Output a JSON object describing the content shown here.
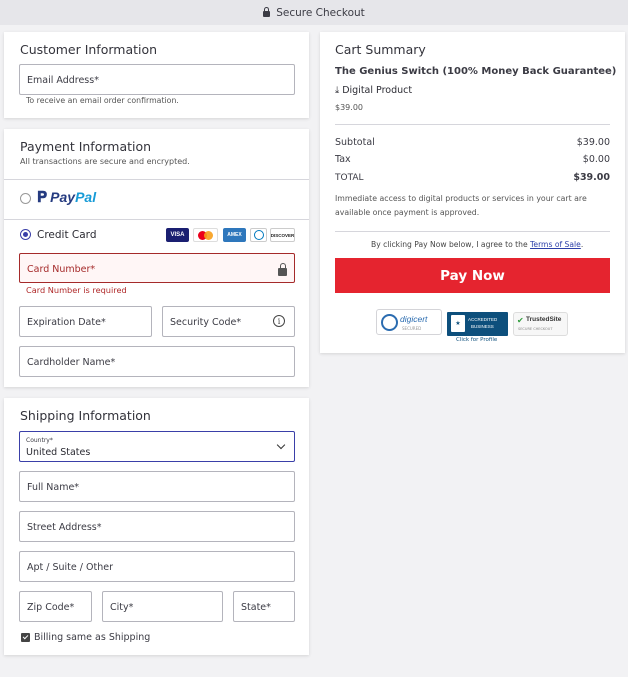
{
  "header": {
    "title": "Secure Checkout"
  },
  "customer": {
    "title": "Customer Information",
    "email_label": "Email Address*",
    "email_hint": "To receive an email order confirmation."
  },
  "payment": {
    "title": "Payment Information",
    "subtitle": "All transactions are secure and encrypted.",
    "paypal_a": "Pay",
    "paypal_b": "Pal",
    "credit_card_label": "Credit Card",
    "card_logos": [
      "VISA",
      "mastercard",
      "AMEX",
      "Diners",
      "DISCOVER"
    ],
    "card_number_label": "Card Number*",
    "card_number_error": "Card Number is required",
    "expiration_label": "Expiration Date*",
    "security_code_label": "Security Code*",
    "cardholder_label": "Cardholder Name*",
    "info_glyph": "i"
  },
  "shipping": {
    "title": "Shipping Information",
    "country_label": "Country*",
    "country_value": "United States",
    "full_name_label": "Full Name*",
    "street_label": "Street Address*",
    "apt_label": "Apt / Suite / Other",
    "zip_label": "Zip Code*",
    "city_label": "City*",
    "state_label": "State*",
    "billing_same_label": "Billing same as Shipping"
  },
  "cart": {
    "title": "Cart Summary",
    "product_name": "The Genius Switch (100% Money Back Guarantee)",
    "product_type": "Digital Product",
    "product_price": "$39.00",
    "subtotal_label": "Subtotal",
    "subtotal_value": "$39.00",
    "tax_label": "Tax",
    "tax_value": "$0.00",
    "total_label": "TOTAL",
    "total_value": "$39.00",
    "access_note": "Immediate access to digital products or services in your cart are available once payment is approved.",
    "terms_prefix": "By clicking Pay Now below, I agree to the",
    "terms_link": "Terms of Sale",
    "terms_suffix": ".",
    "pay_button": "Pay Now",
    "badges": {
      "digicert": "digicert",
      "digicert_sub": "SECURED",
      "bbb_a": "ACCREDITED",
      "bbb_b": "BUSINESS",
      "bbb_caption": "Click for Profile",
      "trusted": "TrustedSite",
      "trusted_sub": "SECURE CHECKOUT"
    }
  },
  "colors": {
    "accent": "#3a3fa8",
    "pay_button": "#e5242f",
    "error": "#a52a2a",
    "paypal_dark": "#253b80",
    "paypal_light": "#179bd7"
  }
}
